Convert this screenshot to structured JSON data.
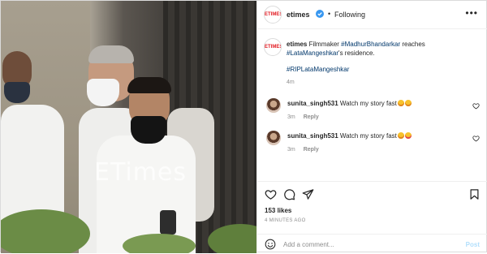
{
  "header": {
    "avatar_text": "ETIMES",
    "username": "etimes",
    "separator": "•",
    "follow_label": "Following",
    "more_icon": "more-options-icon",
    "verified_icon": "verified-badge-icon",
    "verified_color": "#3897f0"
  },
  "photo": {
    "watermark": "ETimes"
  },
  "caption": {
    "username": "etimes",
    "text_lead": "Filmmaker",
    "mention_1": "#MadhurBhandarkar",
    "text_mid": "reaches",
    "mention_2": "#LataMangeshkar",
    "text_tail": "'s residence.",
    "hashtag": "#RIPLataMangeshkar",
    "time": "4m"
  },
  "comments": [
    {
      "username": "sunita_singh531",
      "text": "Watch my story fast",
      "emojis": [
        "grinning-face-icon",
        "grinning-face-icon"
      ],
      "time": "3m",
      "reply_label": "Reply"
    },
    {
      "username": "sunita_singh531",
      "text": "Watch my story fast",
      "emojis": [
        "grinning-face-icon",
        "heart-eyes-face-icon"
      ],
      "time": "3m",
      "reply_label": "Reply"
    }
  ],
  "actions": {
    "icons": [
      "heart-icon",
      "comment-icon",
      "share-icon",
      "bookmark-icon"
    ],
    "likes": "153 likes",
    "posted_ago": "4 MINUTES AGO"
  },
  "add_comment": {
    "placeholder": "Add a comment...",
    "post_label": "Post",
    "post_color": "#b2dffc",
    "emoji_icon": "emoji-smiley-icon"
  },
  "colors": {
    "link": "#00376b",
    "muted": "#8e8e8e",
    "brand_red": "#e21b22"
  }
}
